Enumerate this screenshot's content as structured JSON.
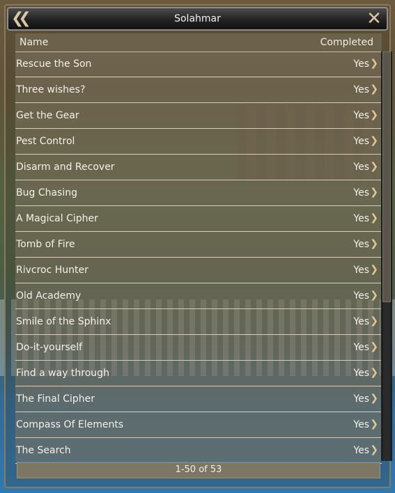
{
  "window": {
    "title": "Solahmar"
  },
  "icons": {
    "back": "double-chevron-left-icon",
    "close": "close-x-icon",
    "row_arrow": "chevron-right-icon"
  },
  "table": {
    "columns": {
      "name": "Name",
      "completed": "Completed"
    },
    "rows": [
      {
        "name": "Rescue the Son",
        "completed": "Yes"
      },
      {
        "name": "Three wishes?",
        "completed": "Yes"
      },
      {
        "name": "Get the Gear",
        "completed": "Yes"
      },
      {
        "name": "Pest Control",
        "completed": "Yes"
      },
      {
        "name": "Disarm and Recover",
        "completed": "Yes"
      },
      {
        "name": "Bug Chasing",
        "completed": "Yes"
      },
      {
        "name": "A Magical Cipher",
        "completed": "Yes"
      },
      {
        "name": "Tomb of Fire",
        "completed": "Yes"
      },
      {
        "name": "Rivcroc Hunter",
        "completed": "Yes"
      },
      {
        "name": "Old Academy",
        "completed": "Yes"
      },
      {
        "name": "Smile of the Sphinx",
        "completed": "Yes"
      },
      {
        "name": "Do-it-yourself",
        "completed": "Yes"
      },
      {
        "name": "Find a way through",
        "completed": "Yes"
      },
      {
        "name": "The Final Cipher",
        "completed": "Yes"
      },
      {
        "name": "Compass Of Elements",
        "completed": "Yes"
      },
      {
        "name": "The Search",
        "completed": "Yes"
      }
    ]
  },
  "pagination": {
    "label": "1-50 of 53"
  }
}
